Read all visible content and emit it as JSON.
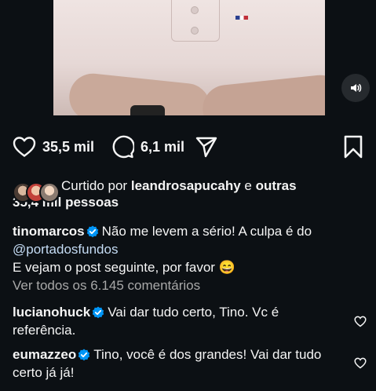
{
  "actions": {
    "likes_count": "35,5 mil",
    "comments_count": "6,1 mil"
  },
  "liked_by": {
    "prefix": "Curtido por",
    "user": "leandrosapucahy",
    "conj": "e",
    "others": "outras",
    "others_count": "35,4 mil pessoas"
  },
  "caption": {
    "username": "tinomarcos",
    "text1": "Não me levem a sério! A culpa é do",
    "mention": "@portadosfundos",
    "text2": "E vejam o post seguinte, por favor 😄"
  },
  "view_all": "Ver todos os 6.145 comentários",
  "comments": [
    {
      "username": "lucianohuck",
      "text1": "Vai dar tudo certo, Tino. Vc é",
      "text2": "referência."
    },
    {
      "username": "eumazzeo",
      "text1": "Tino, você é dos grandes! Vai dar tudo",
      "text2": "certo já já!"
    }
  ],
  "colors": {
    "background": "#0c1014",
    "verified": "#0095f6",
    "muted": "#a8a8a8"
  },
  "icons": [
    "sound-icon",
    "heart-icon",
    "comment-icon",
    "share-icon",
    "bookmark-icon",
    "verified-icon"
  ]
}
